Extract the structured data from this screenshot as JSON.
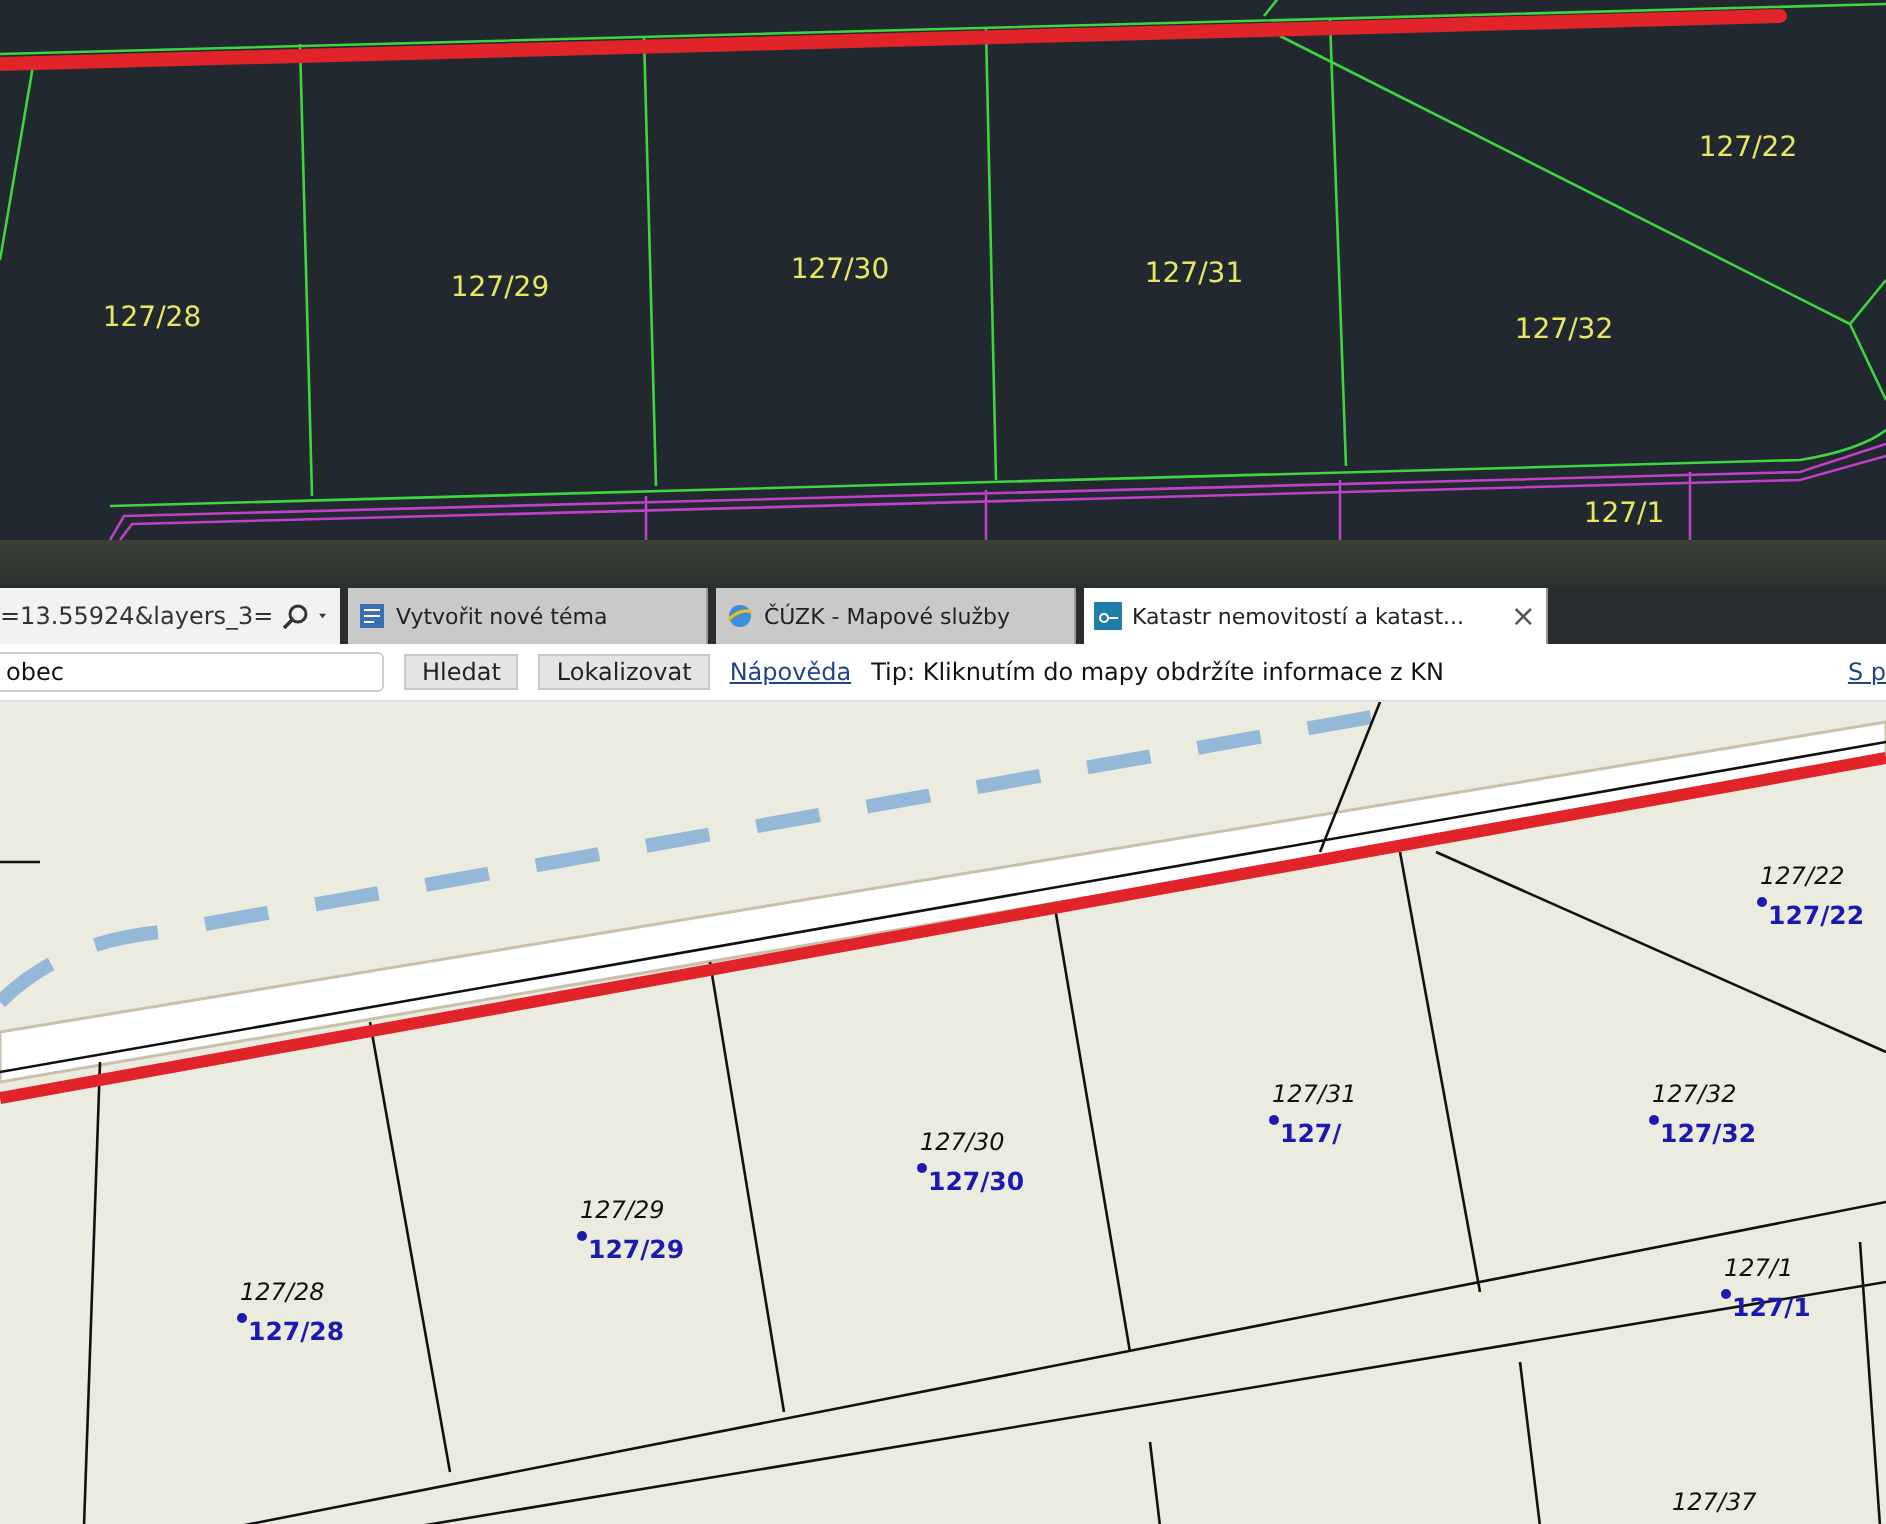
{
  "cad_map": {
    "parcel_labels": [
      "127/22",
      "127/28",
      "127/29",
      "127/30",
      "127/31",
      "127/32",
      "127/1"
    ]
  },
  "browser": {
    "address_fragment": "=13.55924&layers_3=",
    "tabs": [
      {
        "title": "Vytvořit nové téma",
        "selected": false
      },
      {
        "title": "ČÚZK - Mapové služby",
        "selected": false
      },
      {
        "title": "Katastr nemovitostí a katast...",
        "selected": true
      }
    ],
    "close_glyph": "×"
  },
  "toolbar": {
    "search_value": "obec",
    "buttons": [
      "Hledat",
      "Lokalizovat"
    ],
    "help_link": "Nápověda",
    "tip": "Tip: Kliknutím do mapy obdržíte informace z KN",
    "right_link": "S p"
  },
  "cadastral_map": {
    "parcels": [
      {
        "number": "127/22",
        "marker": "127/22"
      },
      {
        "number": "127/28",
        "marker": "127/28"
      },
      {
        "number": "127/29",
        "marker": "127/29"
      },
      {
        "number": "127/30",
        "marker": "127/30"
      },
      {
        "number": "127/31",
        "marker": "127/"
      },
      {
        "number": "127/32",
        "marker": "127/32"
      },
      {
        "number": "127/1",
        "marker": "127/1"
      },
      {
        "number": "127/37"
      }
    ]
  }
}
